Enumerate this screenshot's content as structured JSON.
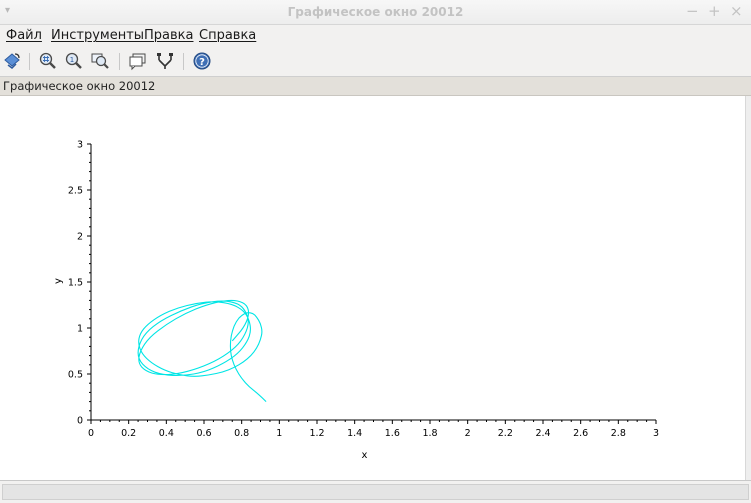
{
  "window": {
    "title": "Графическое окно 20012",
    "menu_glyph": "▾",
    "minimize_glyph": "−",
    "maximize_glyph": "+",
    "close_glyph": "×"
  },
  "menubar": {
    "items": [
      "Файл",
      "Инструменты",
      "Правка",
      "Справка"
    ]
  },
  "toolbar": {
    "icons": [
      "rotate-icon",
      "zoom-grid-icon",
      "zoom-in-icon",
      "zoom-area-icon",
      "datatip-icon",
      "edit-axes-icon",
      "help-icon"
    ]
  },
  "infobar": {
    "text": "Графическое окно 20012"
  },
  "colors": {
    "curve": "#00e5e5",
    "axis": "#000000"
  },
  "chart_data": {
    "type": "line",
    "title": "",
    "xlabel": "x",
    "ylabel": "y",
    "xlim": [
      0,
      3
    ],
    "ylim": [
      0,
      3
    ],
    "xticks": [
      0,
      0.2,
      0.4,
      0.6,
      0.8,
      1,
      1.2,
      1.4,
      1.6,
      1.8,
      2,
      2.2,
      2.4,
      2.6,
      2.8,
      3
    ],
    "xtick_labels": [
      "0",
      "0.2",
      "0.4",
      "0.6",
      "0.8",
      "1",
      "1.2",
      "1.4",
      "1.6",
      "1.8",
      "2",
      "2.2",
      "2.4",
      "2.6",
      "2.8",
      "3"
    ],
    "yticks": [
      0,
      0.5,
      1,
      1.5,
      2,
      2.5,
      3
    ],
    "ytick_labels": [
      "0",
      "0.5",
      "1",
      "1.5",
      "2",
      "2.5",
      "3"
    ],
    "grid": false,
    "series": [
      {
        "x": [
          0.93,
          0.89,
          0.84,
          0.8,
          0.77,
          0.75,
          0.74,
          0.74,
          0.75,
          0.77,
          0.8,
          0.83,
          0.86,
          0.88,
          0.9,
          0.91,
          0.9,
          0.88,
          0.85,
          0.81,
          0.76,
          0.7,
          0.63,
          0.55,
          0.47,
          0.39,
          0.32,
          0.27,
          0.25,
          0.26,
          0.3,
          0.37,
          0.46,
          0.56,
          0.66,
          0.75,
          0.81,
          0.84,
          0.85,
          0.83,
          0.78,
          0.7,
          0.6,
          0.49,
          0.38,
          0.3,
          0.25,
          0.25,
          0.29,
          0.37,
          0.48,
          0.59,
          0.7,
          0.78,
          0.82,
          0.84,
          0.82,
          0.77,
          0.68,
          0.57,
          0.46,
          0.36,
          0.29,
          0.25,
          0.26,
          0.31,
          0.4,
          0.5,
          0.61,
          0.71,
          0.78,
          0.83,
          0.84,
          0.81,
          0.75
        ],
        "y": [
          0.2,
          0.28,
          0.36,
          0.45,
          0.55,
          0.65,
          0.75,
          0.86,
          0.97,
          1.07,
          1.14,
          1.17,
          1.16,
          1.12,
          1.05,
          0.96,
          0.87,
          0.78,
          0.7,
          0.63,
          0.57,
          0.52,
          0.49,
          0.47,
          0.49,
          0.54,
          0.62,
          0.72,
          0.83,
          0.94,
          1.04,
          1.14,
          1.22,
          1.27,
          1.29,
          1.26,
          1.19,
          1.09,
          0.97,
          0.85,
          0.72,
          0.61,
          0.52,
          0.48,
          0.49,
          0.55,
          0.66,
          0.8,
          0.95,
          1.08,
          1.19,
          1.27,
          1.3,
          1.27,
          1.19,
          1.07,
          0.93,
          0.79,
          0.66,
          0.56,
          0.5,
          0.49,
          0.53,
          0.62,
          0.75,
          0.9,
          1.04,
          1.16,
          1.25,
          1.3,
          1.3,
          1.25,
          1.14,
          1.0,
          0.86
        ]
      }
    ]
  }
}
